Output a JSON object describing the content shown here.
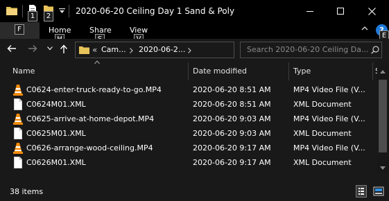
{
  "window": {
    "title": "2020-06-20 Ceiling Day 1 Sand & Poly"
  },
  "keytips": {
    "properties": "1",
    "new_folder": "2",
    "file": "F",
    "home": "H",
    "share": "S",
    "view": "V",
    "help": "E"
  },
  "ribbon": {
    "tabs": [
      "Home",
      "Share",
      "View"
    ],
    "help": "?"
  },
  "address": {
    "overflow": "«",
    "parts": [
      "Cam...",
      "2020-06-2..."
    ]
  },
  "search": {
    "placeholder": "Search 2020-06-20 Ceiling Da..."
  },
  "columns": {
    "name": "Name",
    "date": "Date modified",
    "type": "Type",
    "size": "S"
  },
  "files": [
    {
      "name": "C0624-enter-truck-ready-to-go.MP4",
      "date": "2020-06-20 8:51 AM",
      "type": "MP4 Video File (V...",
      "icon": "vlc-cone-icon"
    },
    {
      "name": "C0624M01.XML",
      "date": "2020-06-20 8:51 AM",
      "type": "XML Document",
      "icon": "document-icon"
    },
    {
      "name": "C0625-arrive-at-home-depot.MP4",
      "date": "2020-06-20 9:03 AM",
      "type": "MP4 Video File (V...",
      "icon": "vlc-cone-icon"
    },
    {
      "name": "C0625M01.XML",
      "date": "2020-06-20 9:03 AM",
      "type": "XML Document",
      "icon": "document-icon"
    },
    {
      "name": "C0626-arrange-wood-ceiling.MP4",
      "date": "2020-06-20 9:17 AM",
      "type": "MP4 Video File (V...",
      "icon": "vlc-cone-icon"
    },
    {
      "name": "C0626M01.XML",
      "date": "2020-06-20 9:17 AM",
      "type": "XML Document",
      "icon": "document-icon"
    }
  ],
  "status": {
    "item_count": "38 items"
  },
  "colors": {
    "background": "#191919",
    "titlebar": "#000000",
    "text": "#ffffff",
    "muted_text": "#8a8a8a",
    "folder_yellow": "#e8c35a",
    "vlc_orange": "#f08a0c",
    "help_blue": "#1f7ad9"
  }
}
